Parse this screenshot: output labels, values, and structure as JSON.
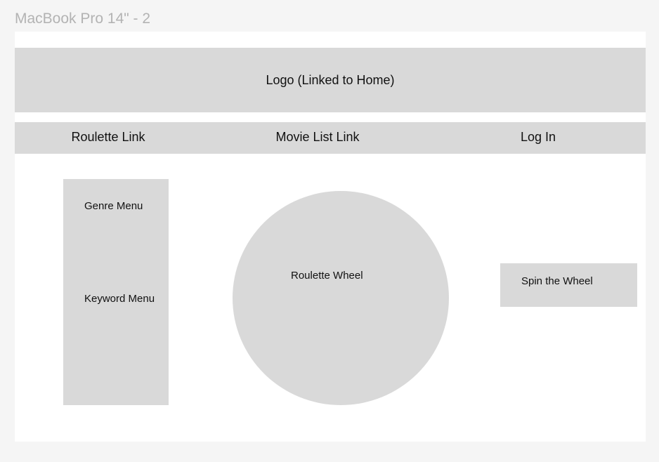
{
  "frame": {
    "title": "MacBook Pro 14\" - 2"
  },
  "header": {
    "logo_label": "Logo (Linked to Home)"
  },
  "nav": {
    "roulette_link": "Roulette Link",
    "movie_list_link": "Movie List Link",
    "login_link": "Log In"
  },
  "sidebar": {
    "genre_menu": "Genre Menu",
    "keyword_menu": "Keyword Menu"
  },
  "main": {
    "wheel_label": "Roulette Wheel",
    "spin_button": "Spin the Wheel"
  },
  "colors": {
    "canvas": "#f5f5f5",
    "frame": "#ffffff",
    "placeholder": "#d9d9d9",
    "frame_title": "#b3b3b3",
    "text": "#111111"
  }
}
